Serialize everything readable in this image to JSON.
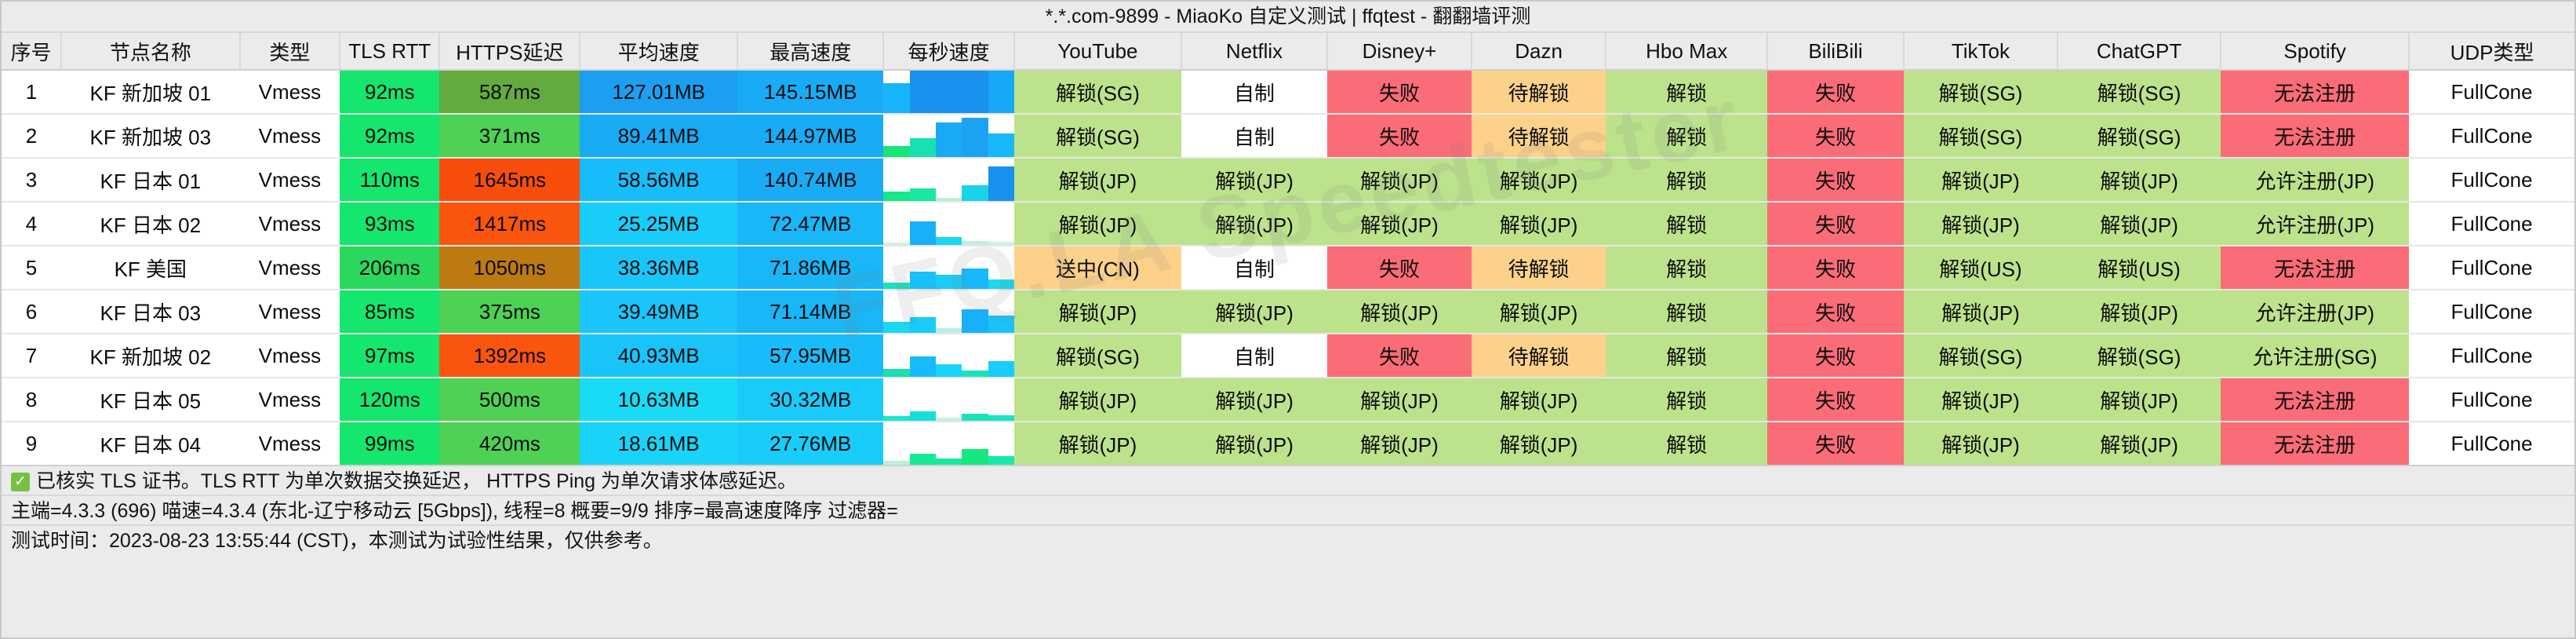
{
  "window": {
    "title": "*.*.com-9899 - MiaoKo 自定义测试 | ffqtest - 翻翻墙评测"
  },
  "watermark": "FFQ.LA  Speedtester",
  "table": {
    "columns": [
      {
        "key": "idx",
        "label": "序号",
        "width": 62
      },
      {
        "key": "name",
        "label": "节点名称",
        "width": 186
      },
      {
        "key": "type",
        "label": "类型",
        "width": 104
      },
      {
        "key": "tls",
        "label": "TLS RTT",
        "width": 104
      },
      {
        "key": "https",
        "label": "HTTPS延迟",
        "width": 146
      },
      {
        "key": "avg",
        "label": "平均速度",
        "width": 164
      },
      {
        "key": "max",
        "label": "最高速度",
        "width": 152
      },
      {
        "key": "persec",
        "label": "每秒速度",
        "width": 136
      },
      {
        "key": "youtube",
        "label": "YouTube",
        "width": 174
      },
      {
        "key": "netflix",
        "label": "Netflix",
        "width": 152
      },
      {
        "key": "disney",
        "label": "Disney+",
        "width": 150
      },
      {
        "key": "dazn",
        "label": "Dazn",
        "width": 140
      },
      {
        "key": "hbomax",
        "label": "Hbo Max",
        "width": 168
      },
      {
        "key": "bilibili",
        "label": "BiliBili",
        "width": 142
      },
      {
        "key": "tiktok",
        "label": "TikTok",
        "width": 160
      },
      {
        "key": "chatgpt",
        "label": "ChatGPT",
        "width": 170
      },
      {
        "key": "spotify",
        "label": "Spotify",
        "width": 196
      },
      {
        "key": "udp",
        "label": "UDP类型",
        "width": 172
      }
    ],
    "rows": [
      {
        "idx": "1",
        "name": "KF 新加坡 01",
        "type": "Vmess",
        "tls": {
          "text": "92ms",
          "bg": "#14e66e"
        },
        "https": {
          "text": "587ms",
          "bg": "#63ab3f"
        },
        "avg": {
          "text": "127.01MB",
          "bg": "#1c9ff0"
        },
        "max": {
          "text": "145.15MB",
          "bg": "#19abf5"
        },
        "spark": [
          {
            "h": 38,
            "c": "#16b5fa"
          },
          {
            "h": 62,
            "c": "#1891ef"
          },
          {
            "h": 62,
            "c": "#1891ef"
          },
          {
            "h": 62,
            "c": "#1891ef"
          },
          {
            "h": 54,
            "c": "#16a7f6"
          }
        ],
        "youtube": {
          "text": "解锁(SG)",
          "bg": "#bce38c"
        },
        "netflix": {
          "text": "自制",
          "bg": "#ffffff"
        },
        "disney": {
          "text": "失败",
          "bg": "#fa6c78"
        },
        "dazn": {
          "text": "待解锁",
          "bg": "#fcd18a"
        },
        "hbomax": {
          "text": "解锁",
          "bg": "#bce38c"
        },
        "bilibili": {
          "text": "失败",
          "bg": "#fa6c78"
        },
        "tiktok": {
          "text": "解锁(SG)",
          "bg": "#bce38c"
        },
        "chatgpt": {
          "text": "解锁(SG)",
          "bg": "#bce38c"
        },
        "spotify": {
          "text": "无法注册",
          "bg": "#fa6c78"
        },
        "udp": {
          "text": "FullCone",
          "bg": "#ffffff"
        }
      },
      {
        "idx": "2",
        "name": "KF 新加坡 03",
        "type": "Vmess",
        "tls": {
          "text": "92ms",
          "bg": "#14e66e"
        },
        "https": {
          "text": "371ms",
          "bg": "#4ed155"
        },
        "avg": {
          "text": "89.41MB",
          "bg": "#19aaf4"
        },
        "max": {
          "text": "144.97MB",
          "bg": "#19abf5"
        },
        "spark": [
          {
            "h": 14,
            "c": "#19e478"
          },
          {
            "h": 24,
            "c": "#19e0b0"
          },
          {
            "h": 44,
            "c": "#19aaf4"
          },
          {
            "h": 50,
            "c": "#1ba3f2"
          },
          {
            "h": 30,
            "c": "#19b8fa"
          }
        ],
        "youtube": {
          "text": "解锁(SG)",
          "bg": "#bce38c"
        },
        "netflix": {
          "text": "自制",
          "bg": "#ffffff"
        },
        "disney": {
          "text": "失败",
          "bg": "#fa6c78"
        },
        "dazn": {
          "text": "待解锁",
          "bg": "#fcd18a"
        },
        "hbomax": {
          "text": "解锁",
          "bg": "#bce38c"
        },
        "bilibili": {
          "text": "失败",
          "bg": "#fa6c78"
        },
        "tiktok": {
          "text": "解锁(SG)",
          "bg": "#bce38c"
        },
        "chatgpt": {
          "text": "解锁(SG)",
          "bg": "#bce38c"
        },
        "spotify": {
          "text": "无法注册",
          "bg": "#fa6c78"
        },
        "udp": {
          "text": "FullCone",
          "bg": "#ffffff"
        }
      },
      {
        "idx": "3",
        "name": "KF 日本 01",
        "type": "Vmess",
        "tls": {
          "text": "110ms",
          "bg": "#14e66e"
        },
        "https": {
          "text": "1645ms",
          "bg": "#f94d0c"
        },
        "avg": {
          "text": "58.56MB",
          "bg": "#17bcfb"
        },
        "max": {
          "text": "140.74MB",
          "bg": "#19abf5"
        },
        "spark": [
          {
            "h": 12,
            "c": "#17e888"
          },
          {
            "h": 16,
            "c": "#1ae7a0"
          },
          {
            "h": 4,
            "c": "#b9f0cf"
          },
          {
            "h": 20,
            "c": "#19d3ea"
          },
          {
            "h": 44,
            "c": "#1891ef"
          }
        ],
        "youtube": {
          "text": "解锁(JP)",
          "bg": "#bce38c"
        },
        "netflix": {
          "text": "解锁(JP)",
          "bg": "#bce38c"
        },
        "disney": {
          "text": "解锁(JP)",
          "bg": "#bce38c"
        },
        "dazn": {
          "text": "解锁(JP)",
          "bg": "#bce38c"
        },
        "hbomax": {
          "text": "解锁",
          "bg": "#bce38c"
        },
        "bilibili": {
          "text": "失败",
          "bg": "#fa6c78"
        },
        "tiktok": {
          "text": "解锁(JP)",
          "bg": "#bce38c"
        },
        "chatgpt": {
          "text": "解锁(JP)",
          "bg": "#bce38c"
        },
        "spotify": {
          "text": "允许注册(JP)",
          "bg": "#bce38c"
        },
        "udp": {
          "text": "FullCone",
          "bg": "#ffffff"
        }
      },
      {
        "idx": "4",
        "name": "KF 日本 02",
        "type": "Vmess",
        "tls": {
          "text": "93ms",
          "bg": "#14e66e"
        },
        "https": {
          "text": "1417ms",
          "bg": "#f9550f"
        },
        "avg": {
          "text": "25.25MB",
          "bg": "#19cdfa"
        },
        "max": {
          "text": "72.47MB",
          "bg": "#19b6f8"
        },
        "spark": [
          {
            "h": 3,
            "c": "#cef2dd"
          },
          {
            "h": 30,
            "c": "#18b0f8"
          },
          {
            "h": 10,
            "c": "#19d8f1"
          },
          {
            "h": 5,
            "c": "#bdefe3"
          },
          {
            "h": 4,
            "c": "#cdf1e8"
          }
        ],
        "youtube": {
          "text": "解锁(JP)",
          "bg": "#bce38c"
        },
        "netflix": {
          "text": "解锁(JP)",
          "bg": "#bce38c"
        },
        "disney": {
          "text": "解锁(JP)",
          "bg": "#bce38c"
        },
        "dazn": {
          "text": "解锁(JP)",
          "bg": "#bce38c"
        },
        "hbomax": {
          "text": "解锁",
          "bg": "#bce38c"
        },
        "bilibili": {
          "text": "失败",
          "bg": "#fa6c78"
        },
        "tiktok": {
          "text": "解锁(JP)",
          "bg": "#bce38c"
        },
        "chatgpt": {
          "text": "解锁(JP)",
          "bg": "#bce38c"
        },
        "spotify": {
          "text": "允许注册(JP)",
          "bg": "#bce38c"
        },
        "udp": {
          "text": "FullCone",
          "bg": "#ffffff"
        }
      },
      {
        "idx": "5",
        "name": "KF 美国",
        "type": "Vmess",
        "tls": {
          "text": "206ms",
          "bg": "#2ad85e"
        },
        "https": {
          "text": "1050ms",
          "bg": "#bd7a12"
        },
        "avg": {
          "text": "38.36MB",
          "bg": "#19c6fa"
        },
        "max": {
          "text": "71.86MB",
          "bg": "#19b6f8"
        },
        "spark": [
          {
            "h": 8,
            "c": "#1ae2c1"
          },
          {
            "h": 22,
            "c": "#19c0fb"
          },
          {
            "h": 18,
            "c": "#19cdfa"
          },
          {
            "h": 26,
            "c": "#18b8fa"
          },
          {
            "h": 12,
            "c": "#19dbee"
          }
        ],
        "youtube": {
          "text": "送中(CN)",
          "bg": "#fcd18a"
        },
        "netflix": {
          "text": "自制",
          "bg": "#ffffff"
        },
        "disney": {
          "text": "失败",
          "bg": "#fa6c78"
        },
        "dazn": {
          "text": "待解锁",
          "bg": "#fcd18a"
        },
        "hbomax": {
          "text": "解锁",
          "bg": "#bce38c"
        },
        "bilibili": {
          "text": "失败",
          "bg": "#fa6c78"
        },
        "tiktok": {
          "text": "解锁(US)",
          "bg": "#bce38c"
        },
        "chatgpt": {
          "text": "解锁(US)",
          "bg": "#bce38c"
        },
        "spotify": {
          "text": "无法注册",
          "bg": "#fa6c78"
        },
        "udp": {
          "text": "FullCone",
          "bg": "#ffffff"
        }
      },
      {
        "idx": "6",
        "name": "KF 日本 03",
        "type": "Vmess",
        "tls": {
          "text": "85ms",
          "bg": "#14e66e"
        },
        "https": {
          "text": "375ms",
          "bg": "#4ed155"
        },
        "avg": {
          "text": "39.49MB",
          "bg": "#19c5fa"
        },
        "max": {
          "text": "71.14MB",
          "bg": "#19b6f8"
        },
        "spark": [
          {
            "h": 14,
            "c": "#19d8f1"
          },
          {
            "h": 20,
            "c": "#19cbfa"
          },
          {
            "h": 6,
            "c": "#b8f0e8"
          },
          {
            "h": 30,
            "c": "#18b0f8"
          },
          {
            "h": 22,
            "c": "#19c3fa"
          }
        ],
        "youtube": {
          "text": "解锁(JP)",
          "bg": "#bce38c"
        },
        "netflix": {
          "text": "解锁(JP)",
          "bg": "#bce38c"
        },
        "disney": {
          "text": "解锁(JP)",
          "bg": "#bce38c"
        },
        "dazn": {
          "text": "解锁(JP)",
          "bg": "#bce38c"
        },
        "hbomax": {
          "text": "解锁",
          "bg": "#bce38c"
        },
        "bilibili": {
          "text": "失败",
          "bg": "#fa6c78"
        },
        "tiktok": {
          "text": "解锁(JP)",
          "bg": "#bce38c"
        },
        "chatgpt": {
          "text": "解锁(JP)",
          "bg": "#bce38c"
        },
        "spotify": {
          "text": "允许注册(JP)",
          "bg": "#bce38c"
        },
        "udp": {
          "text": "FullCone",
          "bg": "#ffffff"
        }
      },
      {
        "idx": "7",
        "name": "KF 新加坡 02",
        "type": "Vmess",
        "tls": {
          "text": "97ms",
          "bg": "#14e66e"
        },
        "https": {
          "text": "1392ms",
          "bg": "#f9550f"
        },
        "avg": {
          "text": "40.93MB",
          "bg": "#19c4fa"
        },
        "max": {
          "text": "57.95MB",
          "bg": "#19bcfa"
        },
        "spark": [
          {
            "h": 10,
            "c": "#19e0b0"
          },
          {
            "h": 26,
            "c": "#18bbfa"
          },
          {
            "h": 16,
            "c": "#19d4f6"
          },
          {
            "h": 8,
            "c": "#1ae3ba"
          },
          {
            "h": 20,
            "c": "#19ccfa"
          }
        ],
        "youtube": {
          "text": "解锁(SG)",
          "bg": "#bce38c"
        },
        "netflix": {
          "text": "自制",
          "bg": "#ffffff"
        },
        "disney": {
          "text": "失败",
          "bg": "#fa6c78"
        },
        "dazn": {
          "text": "待解锁",
          "bg": "#fcd18a"
        },
        "hbomax": {
          "text": "解锁",
          "bg": "#bce38c"
        },
        "bilibili": {
          "text": "失败",
          "bg": "#fa6c78"
        },
        "tiktok": {
          "text": "解锁(SG)",
          "bg": "#bce38c"
        },
        "chatgpt": {
          "text": "解锁(SG)",
          "bg": "#bce38c"
        },
        "spotify": {
          "text": "允许注册(SG)",
          "bg": "#bce38c"
        },
        "udp": {
          "text": "FullCone",
          "bg": "#ffffff"
        }
      },
      {
        "idx": "8",
        "name": "KF 日本 05",
        "type": "Vmess",
        "tls": {
          "text": "120ms",
          "bg": "#14e66e"
        },
        "https": {
          "text": "500ms",
          "bg": "#4ed155"
        },
        "avg": {
          "text": "10.63MB",
          "bg": "#19dbf5"
        },
        "max": {
          "text": "30.32MB",
          "bg": "#19cbfa"
        },
        "spark": [
          {
            "h": 6,
            "c": "#1ae5cd"
          },
          {
            "h": 12,
            "c": "#19ddda"
          },
          {
            "h": 4,
            "c": "#c5f2e3"
          },
          {
            "h": 9,
            "c": "#19e2bb"
          },
          {
            "h": 7,
            "c": "#1ae4c6"
          }
        ],
        "youtube": {
          "text": "解锁(JP)",
          "bg": "#bce38c"
        },
        "netflix": {
          "text": "解锁(JP)",
          "bg": "#bce38c"
        },
        "disney": {
          "text": "解锁(JP)",
          "bg": "#bce38c"
        },
        "dazn": {
          "text": "解锁(JP)",
          "bg": "#bce38c"
        },
        "hbomax": {
          "text": "解锁",
          "bg": "#bce38c"
        },
        "bilibili": {
          "text": "失败",
          "bg": "#fa6c78"
        },
        "tiktok": {
          "text": "解锁(JP)",
          "bg": "#bce38c"
        },
        "chatgpt": {
          "text": "解锁(JP)",
          "bg": "#bce38c"
        },
        "spotify": {
          "text": "无法注册",
          "bg": "#fa6c78"
        },
        "udp": {
          "text": "FullCone",
          "bg": "#ffffff"
        }
      },
      {
        "idx": "9",
        "name": "KF 日本 04",
        "type": "Vmess",
        "tls": {
          "text": "99ms",
          "bg": "#14e66e"
        },
        "https": {
          "text": "420ms",
          "bg": "#4ed155"
        },
        "avg": {
          "text": "18.61MB",
          "bg": "#19d4f8"
        },
        "max": {
          "text": "27.76MB",
          "bg": "#19cdfa"
        },
        "spark": [
          {
            "h": 5,
            "c": "#bdf0d6"
          },
          {
            "h": 14,
            "c": "#17ea95"
          },
          {
            "h": 8,
            "c": "#18e8a2"
          },
          {
            "h": 20,
            "c": "#16e77e"
          },
          {
            "h": 11,
            "c": "#18e9ab"
          }
        ],
        "youtube": {
          "text": "解锁(JP)",
          "bg": "#bce38c"
        },
        "netflix": {
          "text": "解锁(JP)",
          "bg": "#bce38c"
        },
        "disney": {
          "text": "解锁(JP)",
          "bg": "#bce38c"
        },
        "dazn": {
          "text": "解锁(JP)",
          "bg": "#bce38c"
        },
        "hbomax": {
          "text": "解锁",
          "bg": "#bce38c"
        },
        "bilibili": {
          "text": "失败",
          "bg": "#fa6c78"
        },
        "tiktok": {
          "text": "解锁(JP)",
          "bg": "#bce38c"
        },
        "chatgpt": {
          "text": "解锁(JP)",
          "bg": "#bce38c"
        },
        "spotify": {
          "text": "无法注册",
          "bg": "#fa6c78"
        },
        "udp": {
          "text": "FullCone",
          "bg": "#ffffff"
        }
      }
    ]
  },
  "footer": {
    "check_icon": "✓",
    "note1": "已核实 TLS 证书。TLS RTT 为单次数据交换延迟， HTTPS Ping 为单次请求体感延迟。",
    "note2": "主端=4.3.3 (696) 喵速=4.3.4 (东北-辽宁移动云 [5Gbps]), 线程=8 概要=9/9 排序=最高速度降序 过滤器=",
    "note3": "测试时间：2023-08-23 13:55:44 (CST)，本测试为试验性结果，仅供参考。"
  }
}
